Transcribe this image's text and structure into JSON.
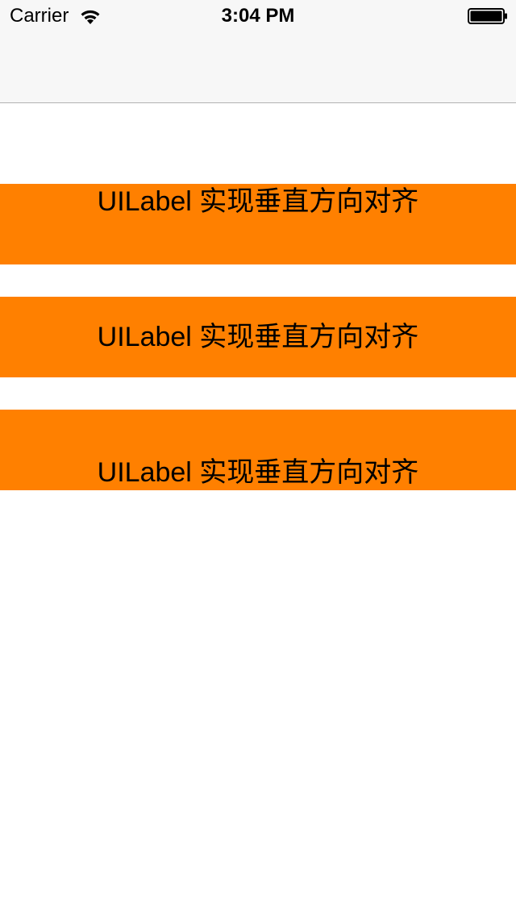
{
  "status_bar": {
    "carrier": "Carrier",
    "time": "3:04 PM",
    "wifi_icon": "wifi-icon",
    "battery_icon": "battery-icon"
  },
  "colors": {
    "label_background": "#FF8000",
    "navbar_background": "#F7F7F7",
    "text": "#000000"
  },
  "labels": [
    {
      "text": "UILabel 实现垂直方向对齐",
      "alignment": "top"
    },
    {
      "text": "UILabel 实现垂直方向对齐",
      "alignment": "center"
    },
    {
      "text": "UILabel 实现垂直方向对齐",
      "alignment": "bottom"
    }
  ]
}
